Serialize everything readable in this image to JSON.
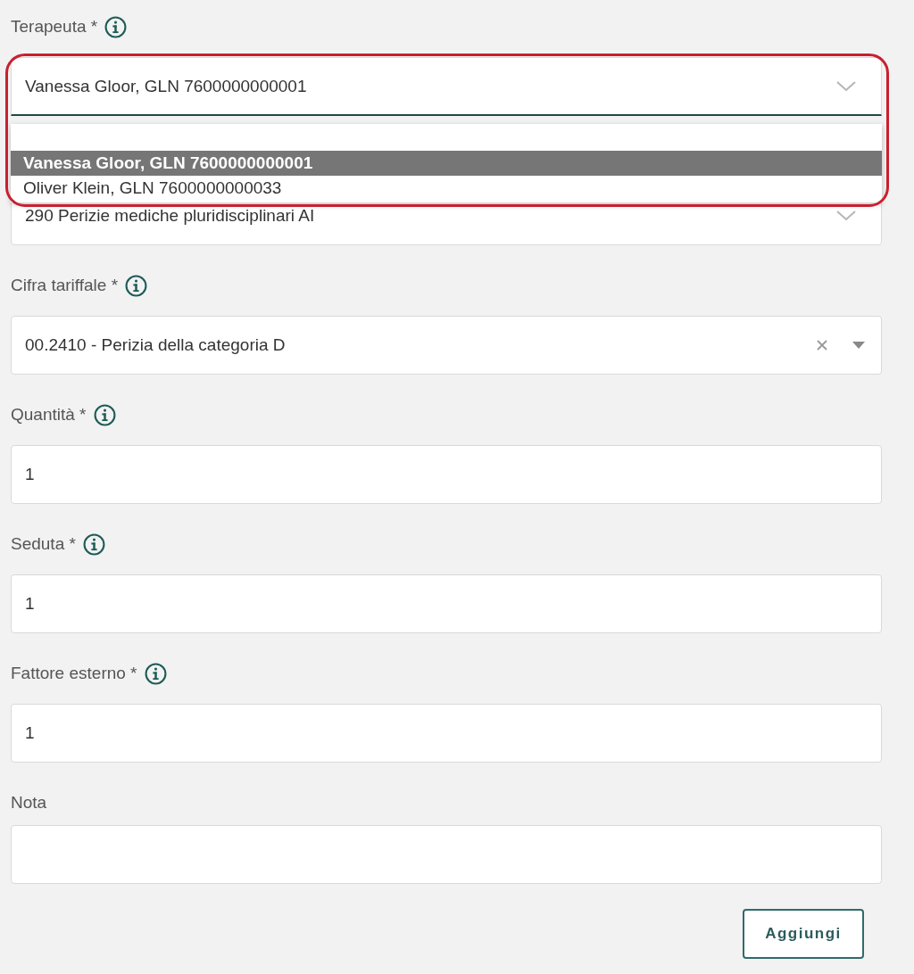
{
  "fields": [
    {
      "kind": "select",
      "label": "Terapeuta *",
      "info": true,
      "value": "Vanessa Gloor, GLN 7600000000001",
      "focused": true,
      "highlighted": true,
      "expanded": true,
      "options": [
        {
          "label": "Vanessa Gloor, GLN 7600000000001",
          "selected": true
        },
        {
          "label": "Oliver Klein, GLN 7600000000033",
          "selected": false
        }
      ]
    },
    {
      "kind": "select",
      "value": "290 Perizie mediche pluridisciplinari AI",
      "focused": false,
      "expanded": false
    },
    {
      "kind": "combo",
      "label": "Cifra tariffale *",
      "info": true,
      "value": "00.2410 - Perizia della categoria D"
    },
    {
      "kind": "input",
      "label": "Quantità *",
      "info": true,
      "value": "1"
    },
    {
      "kind": "input",
      "label": "Seduta *",
      "info": true,
      "value": "1"
    },
    {
      "kind": "input",
      "label": "Fattore esterno *",
      "info": true,
      "value": "1"
    },
    {
      "kind": "input",
      "label": "Nota",
      "info": false
    }
  ],
  "button": "Aggiungi"
}
